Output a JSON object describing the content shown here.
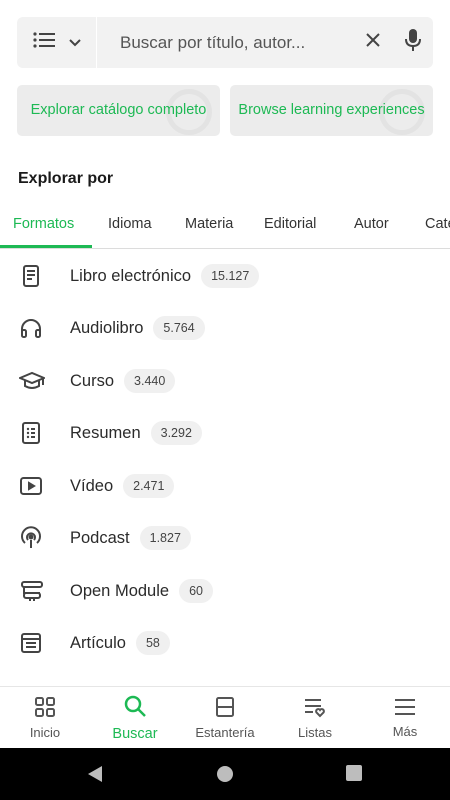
{
  "search": {
    "placeholder": "Buscar por título, autor...",
    "filter_icon": "list-icon",
    "dropdown_icon": "chevron-down-icon",
    "clear_icon": "close-icon",
    "voice_icon": "microphone-icon"
  },
  "promos": {
    "explore_label": "Explorar catálogo completo",
    "learning_label": "Browse learning experiences"
  },
  "section_title": "Explorar por",
  "tabs": [
    {
      "label": "Formatos",
      "active": true
    },
    {
      "label": "Idioma"
    },
    {
      "label": "Materia"
    },
    {
      "label": "Editorial"
    },
    {
      "label": "Autor"
    },
    {
      "label": "Cate"
    }
  ],
  "formats": [
    {
      "label": "Libro electrónico",
      "count": "15.127",
      "icon": "ebook-icon"
    },
    {
      "label": "Audiolibro",
      "count": "5.764",
      "icon": "headphones-icon"
    },
    {
      "label": "Curso",
      "count": "3.440",
      "icon": "graduation-cap-icon"
    },
    {
      "label": "Resumen",
      "count": "3.292",
      "icon": "summary-icon"
    },
    {
      "label": "Vídeo",
      "count": "2.471",
      "icon": "video-icon"
    },
    {
      "label": "Podcast",
      "count": "1.827",
      "icon": "podcast-icon"
    },
    {
      "label": "Open Module",
      "count": "60",
      "icon": "open-module-icon"
    },
    {
      "label": "Artículo",
      "count": "58",
      "icon": "article-icon"
    }
  ],
  "bottom_nav": [
    {
      "label": "Inicio",
      "icon": "home-grid-icon"
    },
    {
      "label": "Buscar",
      "icon": "search-icon",
      "active": true
    },
    {
      "label": "Estantería",
      "icon": "shelf-icon"
    },
    {
      "label": "Listas",
      "icon": "lists-icon"
    },
    {
      "label": "Más",
      "icon": "menu-icon"
    }
  ],
  "colors": {
    "accent": "#1db954",
    "text": "#1f1f1f",
    "badge_bg": "#f0f0f0",
    "search_bg": "#f2f2f2"
  }
}
